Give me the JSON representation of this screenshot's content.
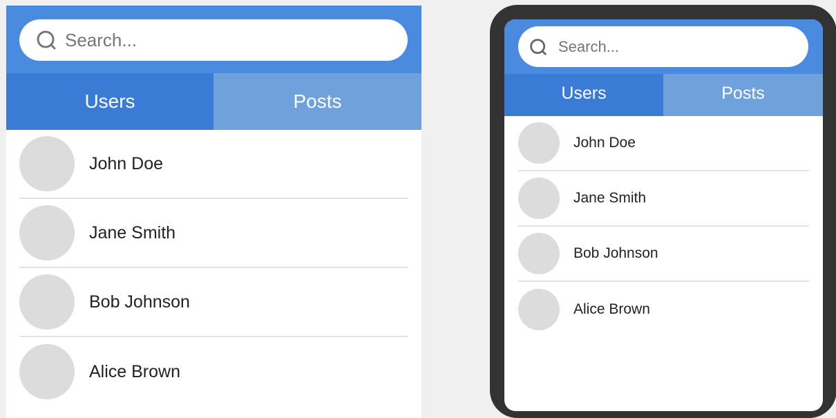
{
  "colors": {
    "header": "#4a8be0",
    "tab_active": "#3a7bd5",
    "tab_inactive": "#6fa2dd",
    "avatar": "#dcdcdc",
    "phone_frame": "#333333",
    "divider": "#e2e2e2"
  },
  "search": {
    "placeholder": "Search...",
    "icon": "search-icon"
  },
  "tabs": [
    {
      "label": "Users",
      "active": true
    },
    {
      "label": "Posts",
      "active": false
    }
  ],
  "users": [
    {
      "name": "John Doe"
    },
    {
      "name": "Jane Smith"
    },
    {
      "name": "Bob Johnson"
    },
    {
      "name": "Alice Brown"
    }
  ]
}
